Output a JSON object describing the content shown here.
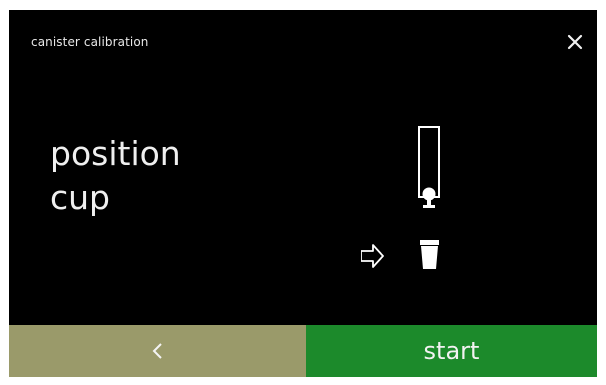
{
  "screen": {
    "title": "canister calibration",
    "message_line1": "position",
    "message_line2": "cup"
  },
  "footer": {
    "back_icon": "chevron-left-icon",
    "start_label": "start"
  },
  "colors": {
    "background": "#000000",
    "back_button": "#9a9a6a",
    "start_button": "#1c8a2b",
    "text": "#efefef"
  },
  "icons": {
    "close": "close-icon",
    "canister": "canister-outlet-icon",
    "arrow": "arrow-right-icon",
    "cup": "cup-icon"
  }
}
